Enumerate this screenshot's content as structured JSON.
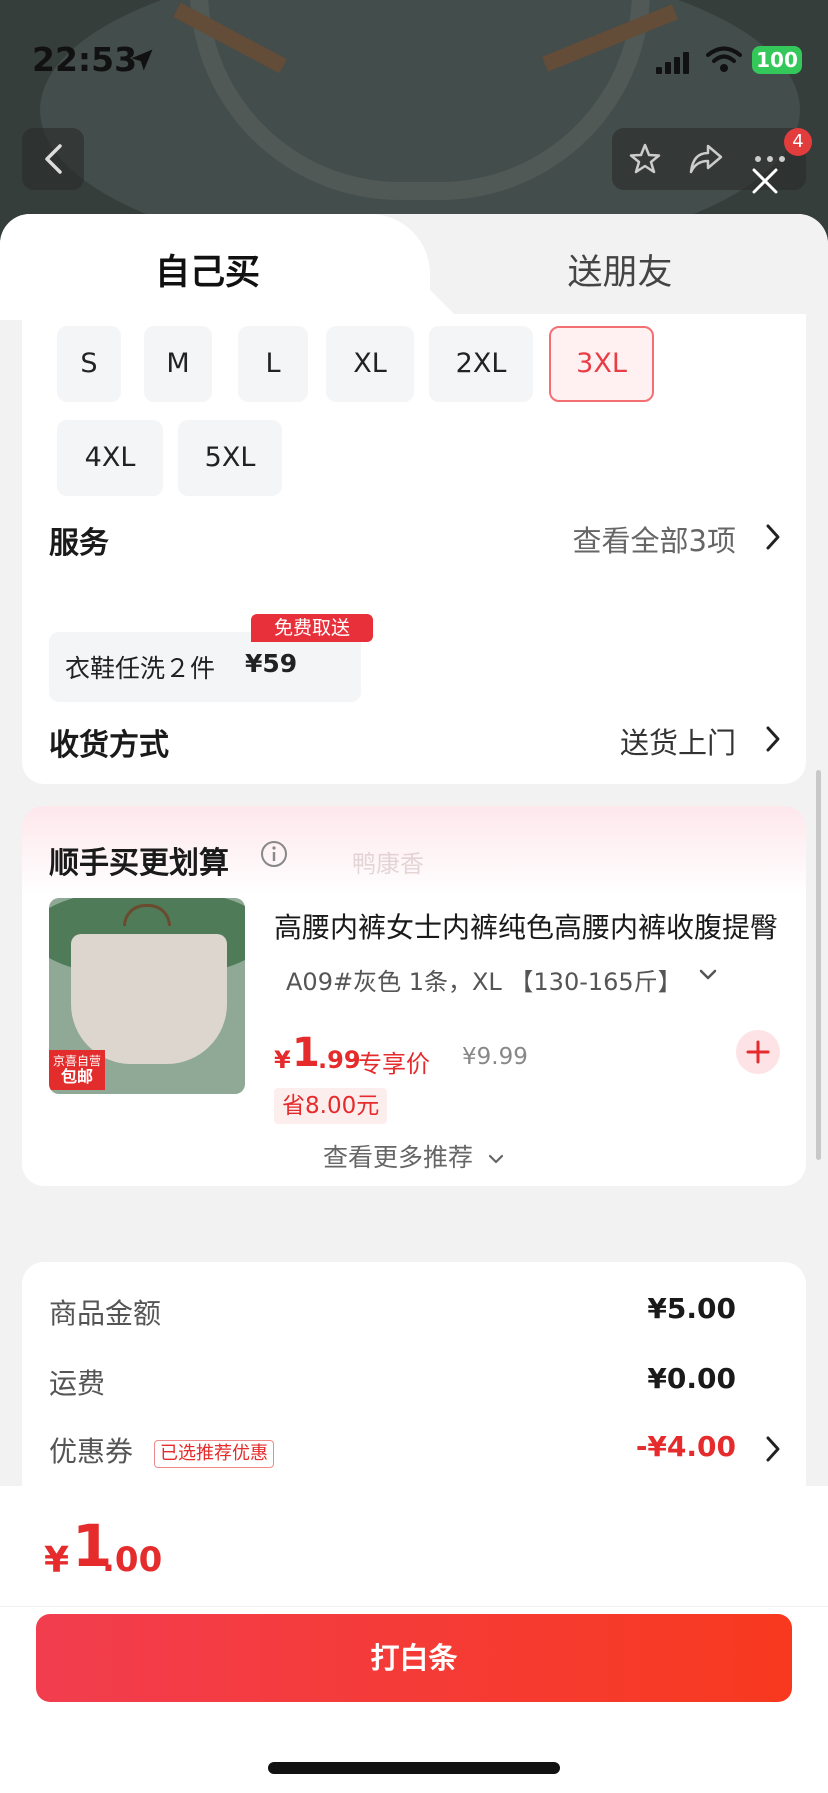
{
  "status_bar": {
    "time": "22:53",
    "battery": "100"
  },
  "header": {
    "more_badge": "4"
  },
  "tabs": [
    {
      "label": "自己买",
      "active": true
    },
    {
      "label": "送朋友",
      "active": false
    }
  ],
  "sizes": [
    {
      "label": "S",
      "selected": false
    },
    {
      "label": "M",
      "selected": false
    },
    {
      "label": "L",
      "selected": false
    },
    {
      "label": "XL",
      "selected": false
    },
    {
      "label": "2XL",
      "selected": false
    },
    {
      "label": "3XL",
      "selected": true
    },
    {
      "label": "4XL",
      "selected": false
    },
    {
      "label": "5XL",
      "selected": false
    }
  ],
  "service": {
    "label": "服务",
    "view_all": "查看全部3项",
    "item_name": "衣鞋任洗２件",
    "item_price": "¥59",
    "item_tag": "免费取送"
  },
  "delivery": {
    "label": "收货方式",
    "value": "送货上门"
  },
  "recommend": {
    "title": "顺手买更划算",
    "watermark": "鸭康香",
    "product_title": "高腰内裤女士内裤纯色高腰内裤收腹提臀",
    "spec": "A09#灰色 1条，XL 【130-165斤】",
    "badge_top": "京喜自营",
    "badge_bottom": "包邮",
    "price_currency": "¥",
    "price_int": "1",
    "price_dec": ".99",
    "price_tag": "专享价",
    "original_price": "¥9.99",
    "save_text": "省8.00元",
    "more_text": "查看更多推荐"
  },
  "summary": {
    "goods_label": "商品金额",
    "goods_value": "¥5.00",
    "shipping_label": "运费",
    "shipping_value": "¥0.00",
    "coupon_label": "优惠券",
    "coupon_tag": "已选推荐优惠",
    "coupon_value": "-¥4.00"
  },
  "footer": {
    "total_currency": "¥",
    "total_int": "1",
    "total_dec": ".00",
    "pay_label": "打白条"
  },
  "colors": {
    "accent": "#e52b2b",
    "selected_border": "#f36f74",
    "battery": "#34c759"
  }
}
